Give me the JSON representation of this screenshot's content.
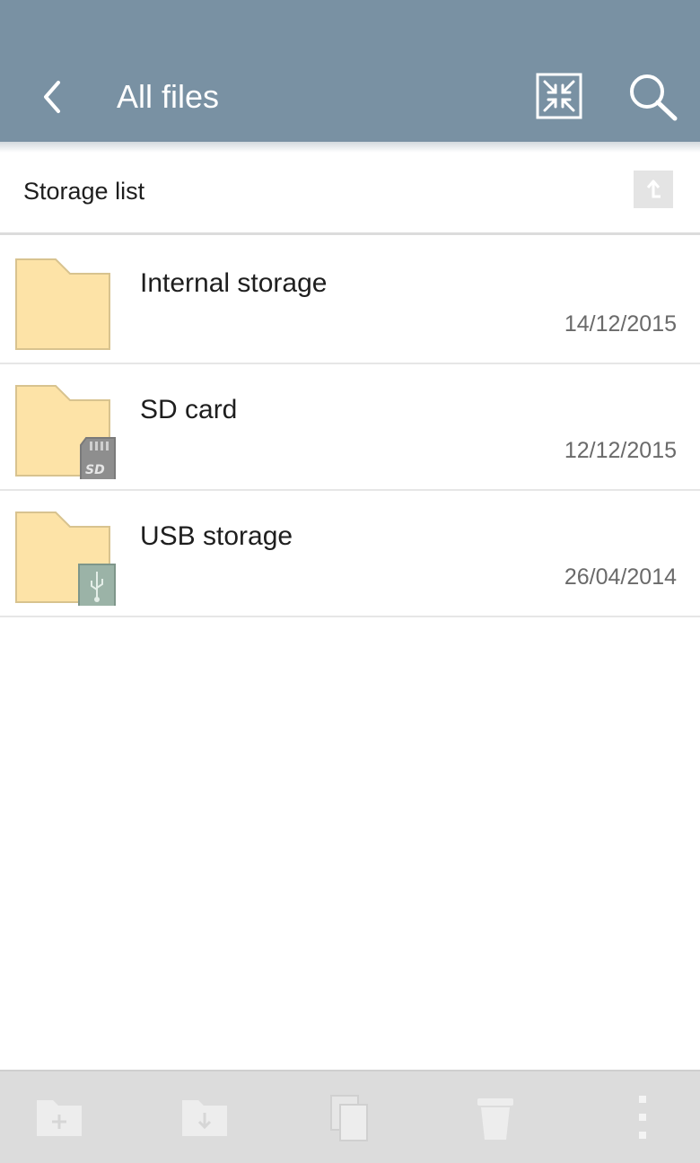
{
  "header": {
    "title": "All files",
    "back_icon": "back-arrow-icon",
    "collapse_icon": "collapse-icon",
    "search_icon": "search-icon"
  },
  "storage_bar": {
    "label": "Storage list",
    "up_icon": "up-level-icon"
  },
  "items": [
    {
      "name": "Internal storage",
      "date": "14/12/2015",
      "icon": "folder-icon"
    },
    {
      "name": "SD card",
      "date": "12/12/2015",
      "icon": "folder-sd-card-icon"
    },
    {
      "name": "USB storage",
      "date": "26/04/2014",
      "icon": "folder-usb-icon"
    }
  ],
  "bottom_bar": {
    "icons": [
      "new-folder-icon",
      "move-icon",
      "copy-icon",
      "delete-icon",
      "more-options-icon"
    ]
  },
  "colors": {
    "app_bar": "#7991a3",
    "folder": "#fde3a7",
    "bottom_bar": "#dcdcdc"
  }
}
